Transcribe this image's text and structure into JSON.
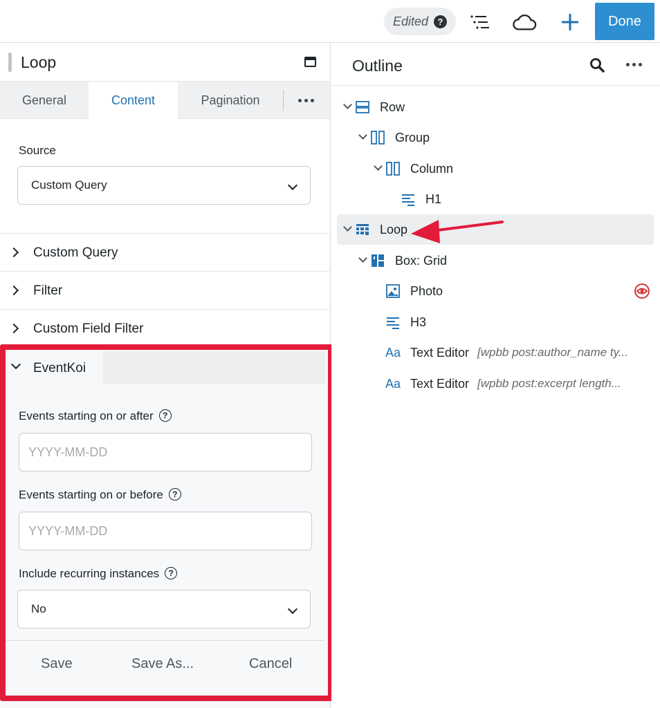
{
  "topbar": {
    "edited_label": "Edited",
    "done_label": "Done",
    "icons": [
      "help-icon",
      "outline-list-icon",
      "cloud-icon",
      "plus-icon"
    ]
  },
  "left_panel": {
    "title": "Loop",
    "tabs": [
      {
        "label": "General",
        "active": false
      },
      {
        "label": "Content",
        "active": true
      },
      {
        "label": "Pagination",
        "active": false
      }
    ],
    "source": {
      "label": "Source",
      "value": "Custom Query"
    },
    "sections": [
      "Custom Query",
      "Filter",
      "Custom Field Filter"
    ],
    "eventkoi": {
      "title": "EventKoi",
      "after_label": "Events starting on or after",
      "after_placeholder": "YYYY-MM-DD",
      "before_label": "Events starting on or before",
      "before_placeholder": "YYYY-MM-DD",
      "recurring_label": "Include recurring instances",
      "recurring_value": "No"
    },
    "footer": {
      "save": "Save",
      "save_as": "Save As...",
      "cancel": "Cancel"
    }
  },
  "outline": {
    "title": "Outline",
    "items": [
      {
        "label": "Row",
        "icon": "row-icon",
        "meta": ""
      },
      {
        "label": "Group",
        "icon": "group-icon",
        "meta": ""
      },
      {
        "label": "Column",
        "icon": "column-icon",
        "meta": ""
      },
      {
        "label": "H1",
        "icon": "heading-icon",
        "meta": ""
      },
      {
        "label": "Loop",
        "icon": "loop-icon",
        "meta": "",
        "selected": true
      },
      {
        "label": "Box: Grid",
        "icon": "grid-icon",
        "meta": ""
      },
      {
        "label": "Photo",
        "icon": "photo-icon",
        "meta": "",
        "hidden": true
      },
      {
        "label": "H3",
        "icon": "heading-icon",
        "meta": ""
      },
      {
        "label": "Text Editor",
        "icon": "text-editor-icon",
        "meta": "[wpbb post:author_name ty..."
      },
      {
        "label": "Text Editor",
        "icon": "text-editor-icon",
        "meta": "[wpbb post:excerpt length..."
      }
    ]
  },
  "colors": {
    "accent": "#2271b1",
    "done_button": "#2d8ed0",
    "highlight": "#e31b3b"
  }
}
